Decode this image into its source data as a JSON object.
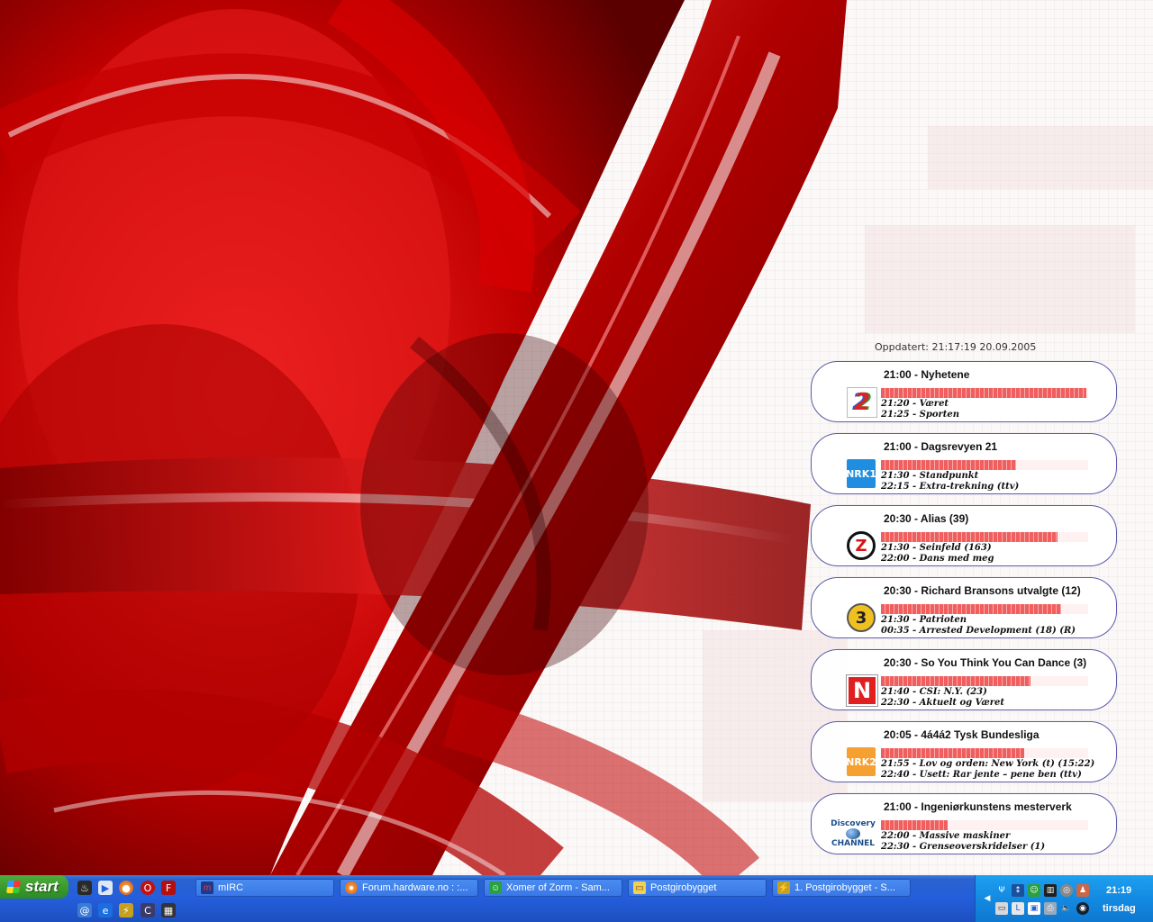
{
  "desktop": {
    "updated_label": "Oppdatert: 21:17:19 20.09.2005"
  },
  "tv_guide": [
    {
      "channel_icon": "tv2-logo-icon",
      "logo_text": "2",
      "now": "21:00 - Nyhetene",
      "progress": 0.99,
      "next1": "21:20 - Været",
      "next2": "21:25 - Sporten"
    },
    {
      "channel_icon": "nrk1-logo-icon",
      "logo_text": "NRK1",
      "now": "21:00 - Dagsrevyen 21",
      "progress": 0.65,
      "next1": "21:30 - Standpunkt",
      "next2": "22:15 - Extra-trekning (ttv)"
    },
    {
      "channel_icon": "zt-logo-icon",
      "logo_text": "Z",
      "now": "20:30 - Alias (39)",
      "progress": 0.85,
      "next1": "21:30 - Seinfeld (163)",
      "next2": "22:00 - Dans med meg"
    },
    {
      "channel_icon": "tv3-logo-icon",
      "logo_text": "3",
      "now": "20:30 - Richard Bransons utvalgte (12)",
      "progress": 0.87,
      "next1": "21:30 - Patrioten",
      "next2": "00:35 - Arrested Development (18) (R)"
    },
    {
      "channel_icon": "tvn-logo-icon",
      "logo_text": "N",
      "now": "20:30 - So You Think You Can Dance (3)",
      "progress": 0.72,
      "next1": "21:40 - CSI: N.Y. (23)",
      "next2": "22:30 - Aktuelt og Været"
    },
    {
      "channel_icon": "nrk2-logo-icon",
      "logo_text": "NRK2",
      "now": "20:05 - 4á4á2 Tysk Bundesliga",
      "progress": 0.69,
      "next1": "21:55 - Lov og orden: New York (t) (15:22)",
      "next2": "22:40 - Usett: Rar jente – pene ben (ttv)"
    },
    {
      "channel_icon": "discovery-logo-icon",
      "logo_text": "Discovery",
      "logo_sub": "CHANNEL",
      "now": "21:00 - Ingeniørkunstens mesterverk",
      "progress": 0.32,
      "next1": "22:00 - Massive maskiner",
      "next2": "22:30 - Grenseoverskridelser (1)"
    }
  ],
  "taskbar": {
    "start_label": "start",
    "tasks": [
      {
        "label": "mIRC",
        "icon": "mirc-icon"
      },
      {
        "label": "Forum.hardware.no : :...",
        "icon": "firefox-icon"
      },
      {
        "label": "Xomer of Zorm - Sam...",
        "icon": "messenger-icon"
      },
      {
        "label": "Postgirobygget",
        "icon": "folder-icon"
      },
      {
        "label": "1. Postgirobygget - S...",
        "icon": "winamp-icon"
      }
    ],
    "clock_time": "21:19",
    "clock_day": "tirsdag"
  },
  "colors": {
    "taskbar_blue": "#245edb",
    "start_green": "#3c9a2e",
    "tray_blue": "#138ae2",
    "wallpaper_red": "#c80000",
    "card_border": "#5a5aa8"
  }
}
